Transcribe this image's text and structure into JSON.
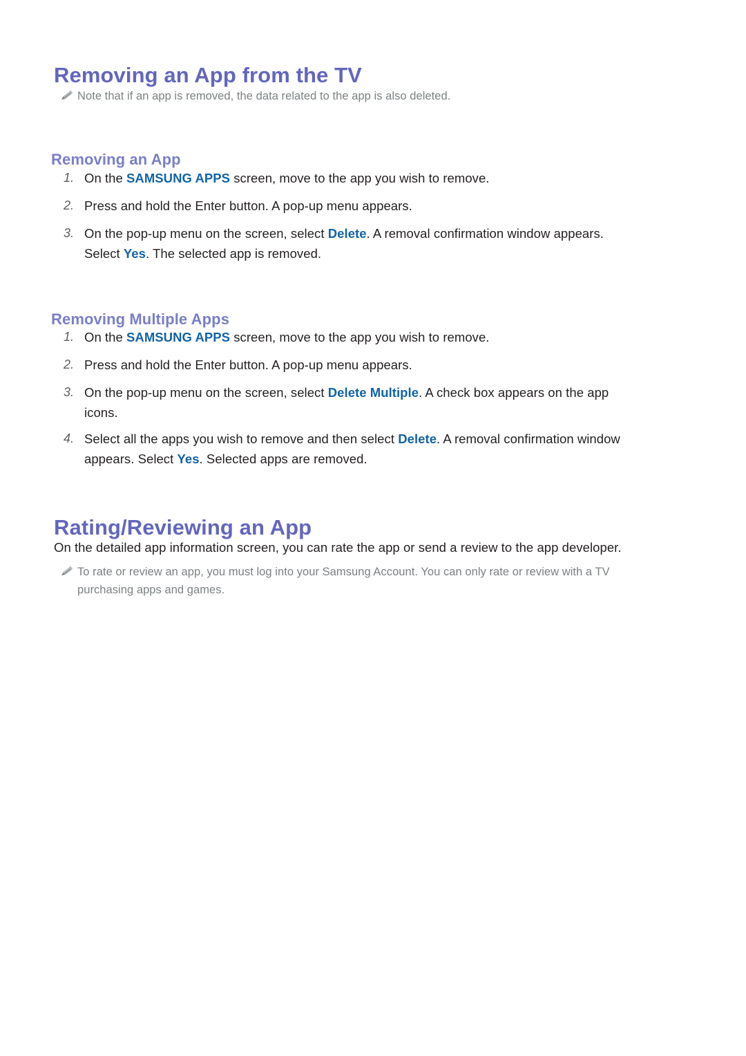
{
  "document": {
    "sections": [
      {
        "id": "removing-app-from-tv",
        "title": "Removing an App from the TV",
        "note": {
          "icon": "pencil-icon",
          "line1": "Note that if an app is removed, the data related to the app is also deleted."
        },
        "subsections": [
          {
            "id": "removing-an-app",
            "title": "Removing an App",
            "steps": [
              {
                "num": "1.",
                "pre": "On the ",
                "accent": "SAMSUNG APPS",
                "post": " screen, move to the app you wish to remove."
              },
              {
                "num": "2.",
                "pre": "Press and hold the Enter button. A pop-up menu appears.",
                "accent": "",
                "post": ""
              },
              {
                "num": "3.",
                "pre": "On the pop-up menu on the screen, select ",
                "accent": "Delete",
                "post": ". A removal confirmation window appears.",
                "line2_pre": "Select ",
                "line2_accent": "Yes",
                "line2_post": ". The selected app is removed."
              }
            ]
          },
          {
            "id": "removing-multiple-apps",
            "title": "Removing Multiple Apps",
            "steps": [
              {
                "num": "1.",
                "pre": "On the ",
                "accent": "SAMSUNG APPS",
                "post": " screen, move to the app you wish to remove."
              },
              {
                "num": "2.",
                "pre": "Press and hold the Enter button. A pop-up menu appears.",
                "accent": "",
                "post": ""
              },
              {
                "num": "3.",
                "pre": "On the pop-up menu on the screen, select ",
                "accent": "Delete Multiple",
                "post": ". A check box appears on the app",
                "line2_pre": "icons.",
                "line2_accent": "",
                "line2_post": ""
              },
              {
                "num": "4.",
                "pre": "Select all the apps you wish to remove and then select ",
                "accent": "Delete",
                "post": ". A removal confirmation window",
                "line2_pre": "appears. Select ",
                "line2_accent": "Yes",
                "line2_post": ". Selected apps are removed."
              }
            ]
          }
        ]
      },
      {
        "id": "rating-reviewing-an-app",
        "title": "Rating/Reviewing an App",
        "paragraph": "On the detailed app information screen, you can rate the app or send a review to the app developer.",
        "note": {
          "icon": "pencil-icon",
          "line1": "To rate or review an app, you must log into your Samsung Account. You can only rate or review with a TV",
          "line2": "purchasing apps and games."
        }
      }
    ]
  },
  "colors": {
    "heading_primary": "#6366bd",
    "heading_secondary": "#7a7ec9",
    "accent_blue": "#1263a8",
    "body_text": "#231f20",
    "note_text": "#7c8183",
    "step_number": "#5b5f62",
    "background": "#ffffff"
  }
}
